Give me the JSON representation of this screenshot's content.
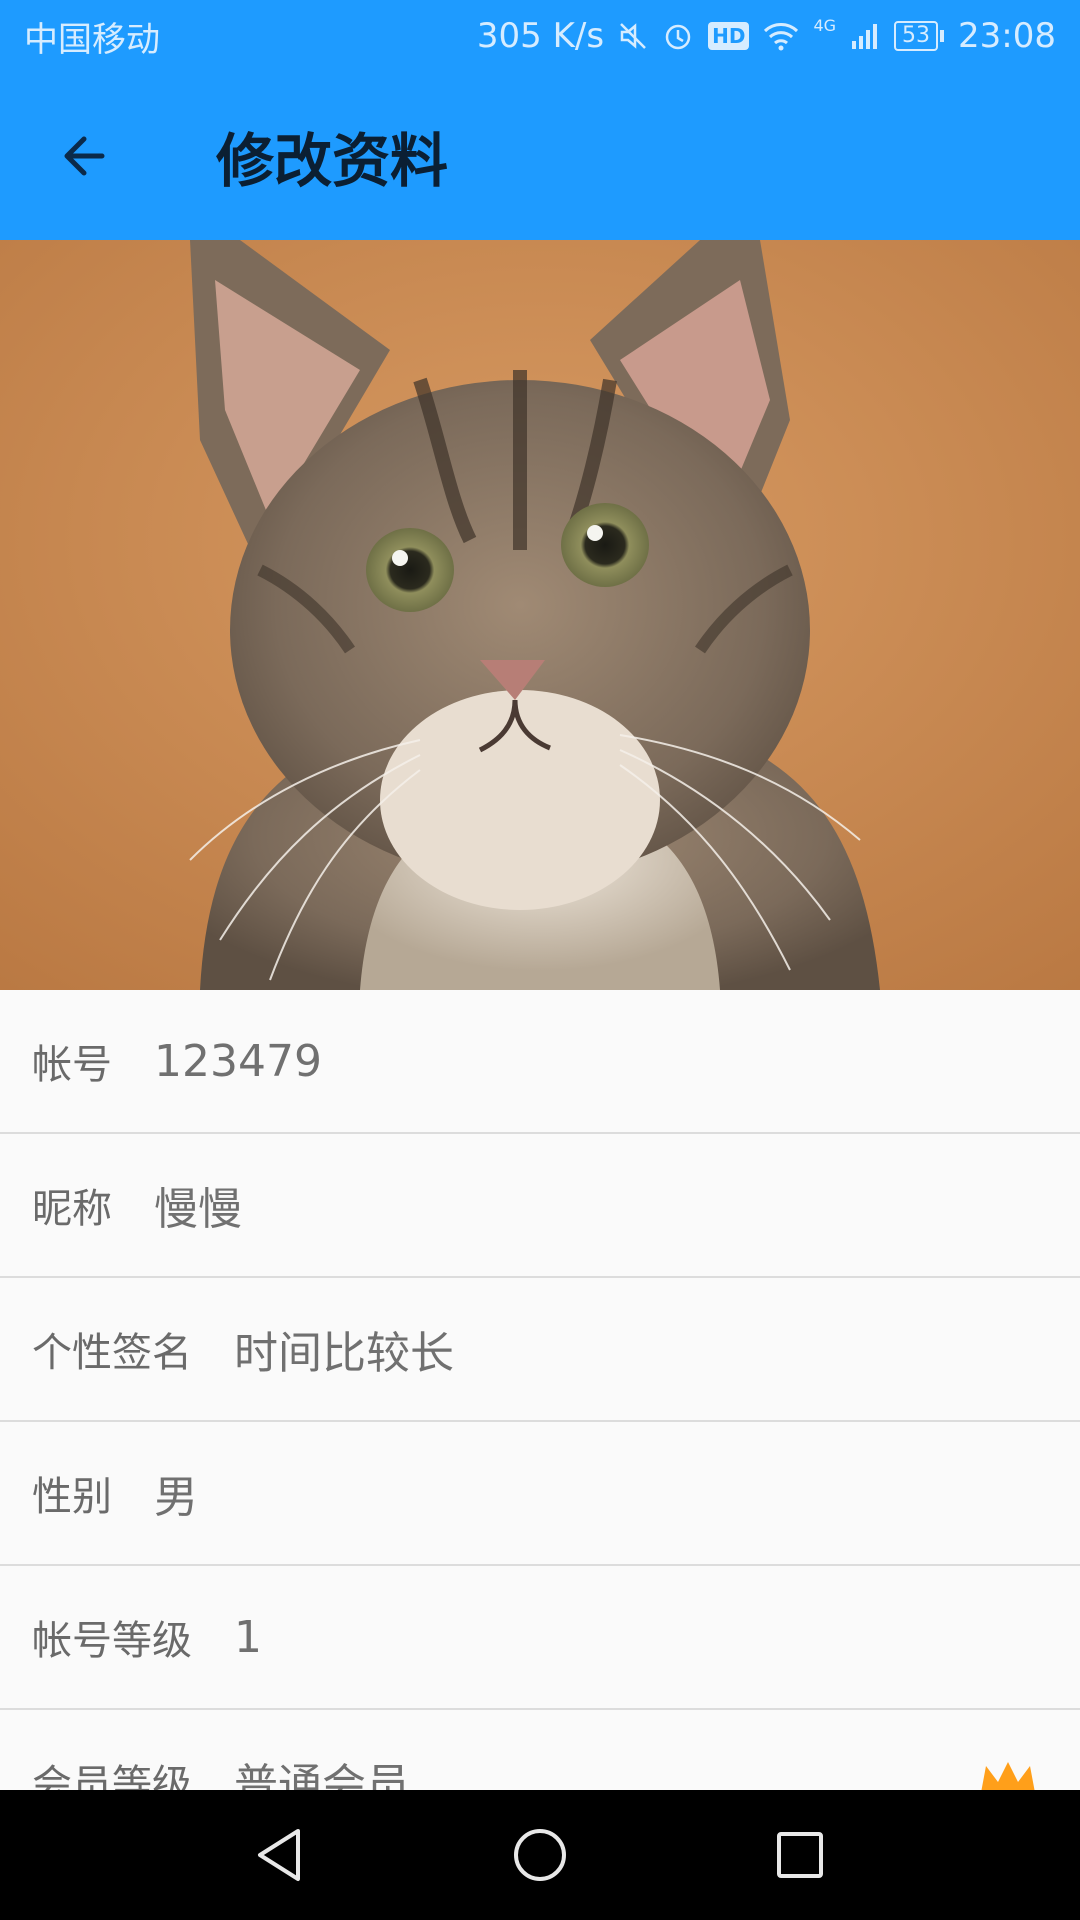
{
  "status_bar": {
    "carrier": "中国移动",
    "speed": "305 K/s",
    "hd": "HD",
    "network": "4G",
    "battery": "53",
    "time": "23:08"
  },
  "app_bar": {
    "title": "修改资料"
  },
  "profile": {
    "rows": [
      {
        "label": "帐号",
        "value": "123479"
      },
      {
        "label": "昵称",
        "value": "慢慢"
      },
      {
        "label": "个性签名",
        "value": "时间比较长"
      },
      {
        "label": "性别",
        "value": "男"
      },
      {
        "label": "帐号等级",
        "value": "1"
      },
      {
        "label": "会员等级",
        "value": "普通会员"
      }
    ]
  },
  "colors": {
    "primary": "#1e9bff",
    "badge": "#ff9f1a"
  },
  "icons": {
    "back": "arrow-left-icon",
    "member_badge": "crown-icon",
    "nav": [
      "back-triangle-icon",
      "home-circle-icon",
      "recents-square-icon"
    ]
  }
}
